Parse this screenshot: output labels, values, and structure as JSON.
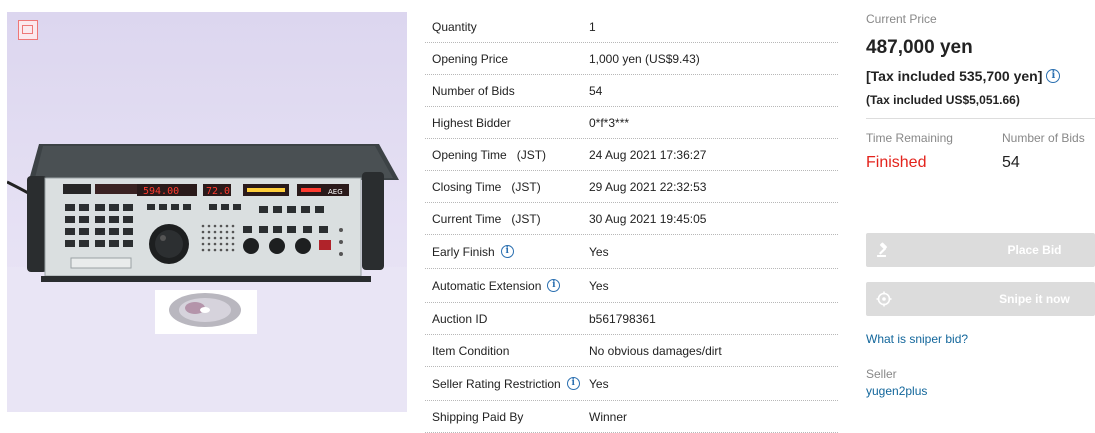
{
  "image": {
    "alt": "",
    "device_label_left": "",
    "device_label_brand": "AEG"
  },
  "details": {
    "rows": [
      {
        "key": "Quantity",
        "value": "1",
        "info": false
      },
      {
        "key": "Opening Price",
        "value": "1,000 yen (US$9.43)",
        "info": false
      },
      {
        "key": "Number of Bids",
        "value": "54",
        "info": false
      },
      {
        "key": "Highest Bidder",
        "value": "0*f*3***",
        "info": false
      },
      {
        "key": "Opening Time   (JST)",
        "value": "24 Aug 2021 17:36:27",
        "info": false
      },
      {
        "key": "Closing Time   (JST)",
        "value": "29 Aug 2021 22:32:53",
        "info": false
      },
      {
        "key": "Current Time   (JST)",
        "value": "30 Aug 2021 19:45:05",
        "info": false
      },
      {
        "key": "Early Finish",
        "value": "Yes",
        "info": true
      },
      {
        "key": "Automatic Extension",
        "value": "Yes",
        "info": true
      },
      {
        "key": "Auction ID",
        "value": "b561798361",
        "info": false
      },
      {
        "key": "Item Condition",
        "value": "No obvious damages/dirt",
        "info": false
      },
      {
        "key": "Seller Rating Restriction",
        "value": "Yes",
        "info": true
      },
      {
        "key": "Shipping Paid By",
        "value": "Winner",
        "info": false
      }
    ]
  },
  "pricing": {
    "current_price_label": "Current Price",
    "price": "487,000 yen",
    "tax_included": "[Tax included 535,700 yen]",
    "tax_included_usd": "(Tax included US$5,051.66)"
  },
  "status": {
    "time_remaining_label": "Time Remaining",
    "time_remaining_value": "Finished",
    "number_of_bids_label": "Number of Bids",
    "number_of_bids_value": "54"
  },
  "actions": {
    "place_bid": "Place Bid",
    "snipe": "Snipe it now",
    "sniper_link": "What is sniper bid?"
  },
  "seller": {
    "label": "Seller",
    "name": "yugen2plus"
  },
  "colors": {
    "finished": "#e3231c",
    "link": "#12669b",
    "button_disabled": "#dcdcdc",
    "info_icon": "#2a6fb0"
  },
  "icons": {
    "gavel": "gavel-icon",
    "target": "target-icon",
    "info": "info-icon",
    "image_badge": "image-badge-icon"
  }
}
